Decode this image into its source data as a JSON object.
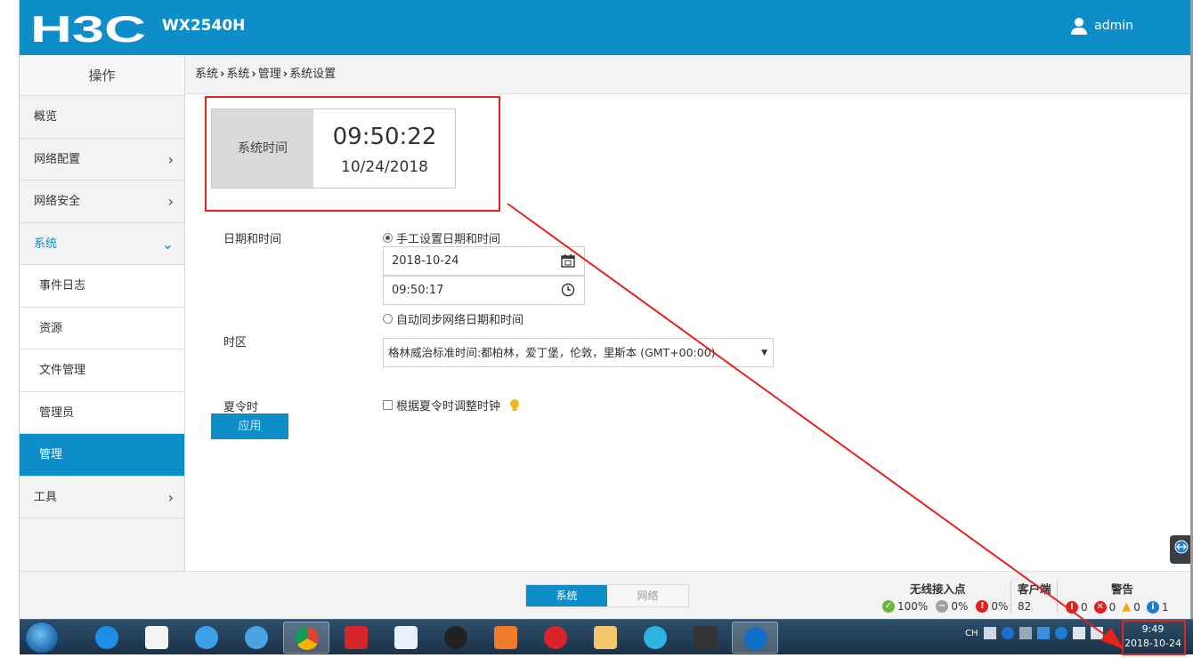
{
  "header": {
    "brand": "H3C",
    "model": "WX2540H",
    "user": "admin"
  },
  "sidebar": {
    "title": "操作",
    "items": [
      {
        "label": "概览"
      },
      {
        "label": "网络配置"
      },
      {
        "label": "网络安全"
      },
      {
        "label": "系统"
      },
      {
        "label": "事件日志"
      },
      {
        "label": "资源"
      },
      {
        "label": "文件管理"
      },
      {
        "label": "管理员"
      },
      {
        "label": "管理"
      },
      {
        "label": "工具"
      }
    ]
  },
  "breadcrumb": [
    "系统",
    "系统",
    "管理",
    "系统设置"
  ],
  "system_time": {
    "label": "系统时间",
    "time": "09:50:22",
    "date": "10/24/2018"
  },
  "form": {
    "datetime_label": "日期和时间",
    "manual_option": "手工设置日期和时间",
    "date_value": "2018-10-24",
    "time_value": "09:50:17",
    "auto_option": "自动同步网络日期和时间",
    "timezone_label": "时区",
    "timezone_value": "格林威治标准时间:都柏林，爱丁堡，伦敦，里斯本 (GMT+00:00)",
    "dst_label": "夏令时",
    "dst_option": "根据夏令时调整时钟",
    "apply": "应用"
  },
  "footer": {
    "tab_on": "系统",
    "tab_off": "网络",
    "ap_title": "无线接入点",
    "ap_green": "100%",
    "ap_gray": "0%",
    "ap_red": "0%",
    "client_title": "客户端",
    "client_count": "82",
    "alert_title": "警告",
    "alert_red1": "0",
    "alert_red2": "0",
    "alert_yellow": "0",
    "alert_info": "1",
    "info_glyph": "i"
  },
  "taskbar": {
    "tray_lang": "CH",
    "clock_time": "9:49",
    "clock_date": "2018-10-24"
  },
  "colors": {
    "accent": "#0d8ec8",
    "highlight": "#e8231b"
  }
}
